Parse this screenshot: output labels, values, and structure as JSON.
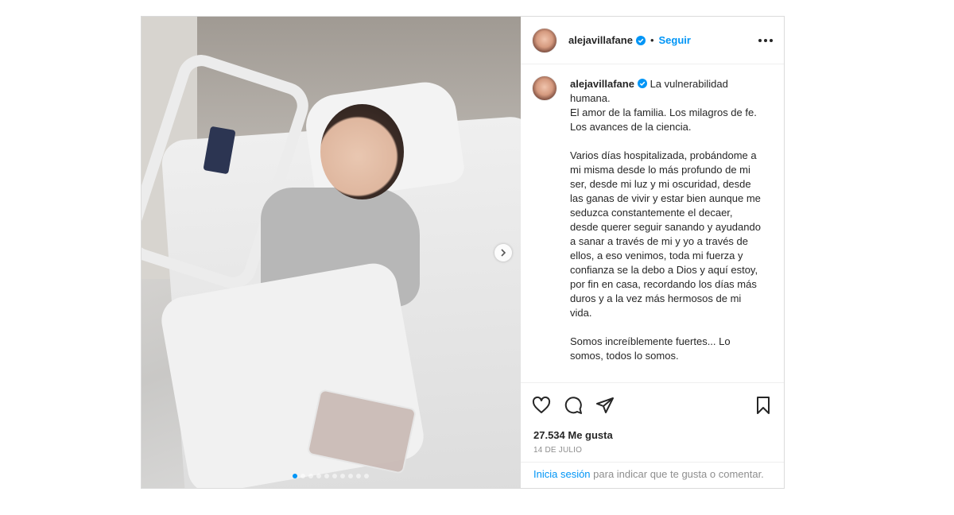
{
  "post": {
    "username": "alejavillafane",
    "verified_icon": "verified-badge-icon",
    "separator": "•",
    "follow_label": "Seguir",
    "caption": "La vulnerabilidad humana.\nEl amor de la familia. Los milagros de fe. Los avances de la ciencia.\n\nVarios días hospitalizada, probándome a mi misma desde lo más profundo de mi ser, desde mi luz y mi oscuridad, desde las ganas de vivir y estar bien aunque me seduzca constantemente el decaer, desde querer seguir sanando y ayudando a sanar a través de mi y yo a través de ellos, a eso venimos, toda mi fuerza y confianza se la debo a Dios y aquí estoy, por fin en casa, recordando los días más duros y a la vez más hermosos de mi vida.\n\nSomos increíblemente fuertes... Lo somos, todos lo somos.",
    "likes": "27.534 Me gusta",
    "date": "14 DE JULIO",
    "login_link": "Inicia sesión",
    "login_rest": " para indicar que te gusta o comentar.",
    "carousel": {
      "total": 10,
      "active": 1
    },
    "colors": {
      "accent": "#0095f6",
      "text": "#262626",
      "muted": "#8e8e8e"
    }
  }
}
